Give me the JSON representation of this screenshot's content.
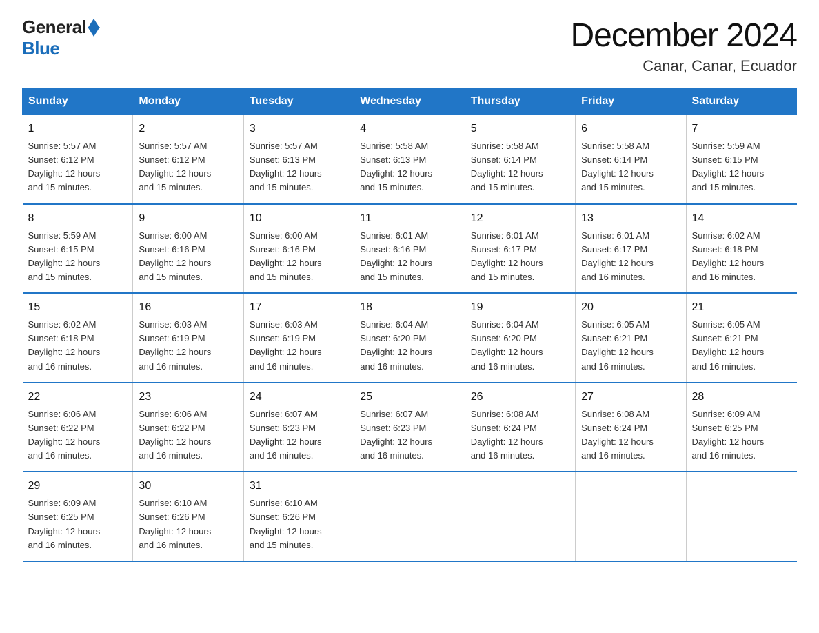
{
  "logo": {
    "general": "General",
    "blue": "Blue"
  },
  "title": "December 2024",
  "location": "Canar, Canar, Ecuador",
  "days_of_week": [
    "Sunday",
    "Monday",
    "Tuesday",
    "Wednesday",
    "Thursday",
    "Friday",
    "Saturday"
  ],
  "weeks": [
    [
      {
        "day": "1",
        "sunrise": "5:57 AM",
        "sunset": "6:12 PM",
        "daylight": "12 hours and 15 minutes."
      },
      {
        "day": "2",
        "sunrise": "5:57 AM",
        "sunset": "6:12 PM",
        "daylight": "12 hours and 15 minutes."
      },
      {
        "day": "3",
        "sunrise": "5:57 AM",
        "sunset": "6:13 PM",
        "daylight": "12 hours and 15 minutes."
      },
      {
        "day": "4",
        "sunrise": "5:58 AM",
        "sunset": "6:13 PM",
        "daylight": "12 hours and 15 minutes."
      },
      {
        "day": "5",
        "sunrise": "5:58 AM",
        "sunset": "6:14 PM",
        "daylight": "12 hours and 15 minutes."
      },
      {
        "day": "6",
        "sunrise": "5:58 AM",
        "sunset": "6:14 PM",
        "daylight": "12 hours and 15 minutes."
      },
      {
        "day": "7",
        "sunrise": "5:59 AM",
        "sunset": "6:15 PM",
        "daylight": "12 hours and 15 minutes."
      }
    ],
    [
      {
        "day": "8",
        "sunrise": "5:59 AM",
        "sunset": "6:15 PM",
        "daylight": "12 hours and 15 minutes."
      },
      {
        "day": "9",
        "sunrise": "6:00 AM",
        "sunset": "6:16 PM",
        "daylight": "12 hours and 15 minutes."
      },
      {
        "day": "10",
        "sunrise": "6:00 AM",
        "sunset": "6:16 PM",
        "daylight": "12 hours and 15 minutes."
      },
      {
        "day": "11",
        "sunrise": "6:01 AM",
        "sunset": "6:16 PM",
        "daylight": "12 hours and 15 minutes."
      },
      {
        "day": "12",
        "sunrise": "6:01 AM",
        "sunset": "6:17 PM",
        "daylight": "12 hours and 15 minutes."
      },
      {
        "day": "13",
        "sunrise": "6:01 AM",
        "sunset": "6:17 PM",
        "daylight": "12 hours and 16 minutes."
      },
      {
        "day": "14",
        "sunrise": "6:02 AM",
        "sunset": "6:18 PM",
        "daylight": "12 hours and 16 minutes."
      }
    ],
    [
      {
        "day": "15",
        "sunrise": "6:02 AM",
        "sunset": "6:18 PM",
        "daylight": "12 hours and 16 minutes."
      },
      {
        "day": "16",
        "sunrise": "6:03 AM",
        "sunset": "6:19 PM",
        "daylight": "12 hours and 16 minutes."
      },
      {
        "day": "17",
        "sunrise": "6:03 AM",
        "sunset": "6:19 PM",
        "daylight": "12 hours and 16 minutes."
      },
      {
        "day": "18",
        "sunrise": "6:04 AM",
        "sunset": "6:20 PM",
        "daylight": "12 hours and 16 minutes."
      },
      {
        "day": "19",
        "sunrise": "6:04 AM",
        "sunset": "6:20 PM",
        "daylight": "12 hours and 16 minutes."
      },
      {
        "day": "20",
        "sunrise": "6:05 AM",
        "sunset": "6:21 PM",
        "daylight": "12 hours and 16 minutes."
      },
      {
        "day": "21",
        "sunrise": "6:05 AM",
        "sunset": "6:21 PM",
        "daylight": "12 hours and 16 minutes."
      }
    ],
    [
      {
        "day": "22",
        "sunrise": "6:06 AM",
        "sunset": "6:22 PM",
        "daylight": "12 hours and 16 minutes."
      },
      {
        "day": "23",
        "sunrise": "6:06 AM",
        "sunset": "6:22 PM",
        "daylight": "12 hours and 16 minutes."
      },
      {
        "day": "24",
        "sunrise": "6:07 AM",
        "sunset": "6:23 PM",
        "daylight": "12 hours and 16 minutes."
      },
      {
        "day": "25",
        "sunrise": "6:07 AM",
        "sunset": "6:23 PM",
        "daylight": "12 hours and 16 minutes."
      },
      {
        "day": "26",
        "sunrise": "6:08 AM",
        "sunset": "6:24 PM",
        "daylight": "12 hours and 16 minutes."
      },
      {
        "day": "27",
        "sunrise": "6:08 AM",
        "sunset": "6:24 PM",
        "daylight": "12 hours and 16 minutes."
      },
      {
        "day": "28",
        "sunrise": "6:09 AM",
        "sunset": "6:25 PM",
        "daylight": "12 hours and 16 minutes."
      }
    ],
    [
      {
        "day": "29",
        "sunrise": "6:09 AM",
        "sunset": "6:25 PM",
        "daylight": "12 hours and 16 minutes."
      },
      {
        "day": "30",
        "sunrise": "6:10 AM",
        "sunset": "6:26 PM",
        "daylight": "12 hours and 16 minutes."
      },
      {
        "day": "31",
        "sunrise": "6:10 AM",
        "sunset": "6:26 PM",
        "daylight": "12 hours and 15 minutes."
      },
      null,
      null,
      null,
      null
    ]
  ],
  "labels": {
    "sunrise": "Sunrise:",
    "sunset": "Sunset:",
    "daylight": "Daylight:"
  }
}
